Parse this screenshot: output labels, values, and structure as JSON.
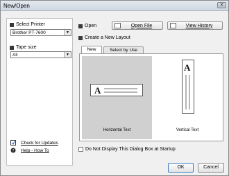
{
  "window": {
    "title": "New/Open",
    "close_label": "✕"
  },
  "left_panel": {
    "select_printer_label": "Select Printer",
    "printer_value": "Brother PT-7600",
    "tape_size_label": "Tape size",
    "tape_size_value": "All",
    "check_updates_label": "Check for Updates",
    "help_label": "Help - How To"
  },
  "options": {
    "open_label": "Open",
    "open_file_button": "Open File",
    "view_history_button": "View History",
    "create_layout_label": "Create a New Layout"
  },
  "tabs": [
    {
      "label": "New",
      "active": true
    },
    {
      "label": "Select by Use",
      "active": false
    }
  ],
  "layouts": [
    {
      "label": "Horizontal Text",
      "glyph": "A",
      "selected": true
    },
    {
      "label": "Vertical Text",
      "glyph": "A",
      "selected": false
    }
  ],
  "footer": {
    "dont_display_label": "Do Not Display This Dialog Box at Startup",
    "ok_button": "OK",
    "cancel_button": "Cancel"
  },
  "icons": [
    "close-icon",
    "bullet-icon",
    "dropdown-arrow-icon",
    "folder-icon",
    "history-icon",
    "update-icon",
    "help-icon"
  ]
}
